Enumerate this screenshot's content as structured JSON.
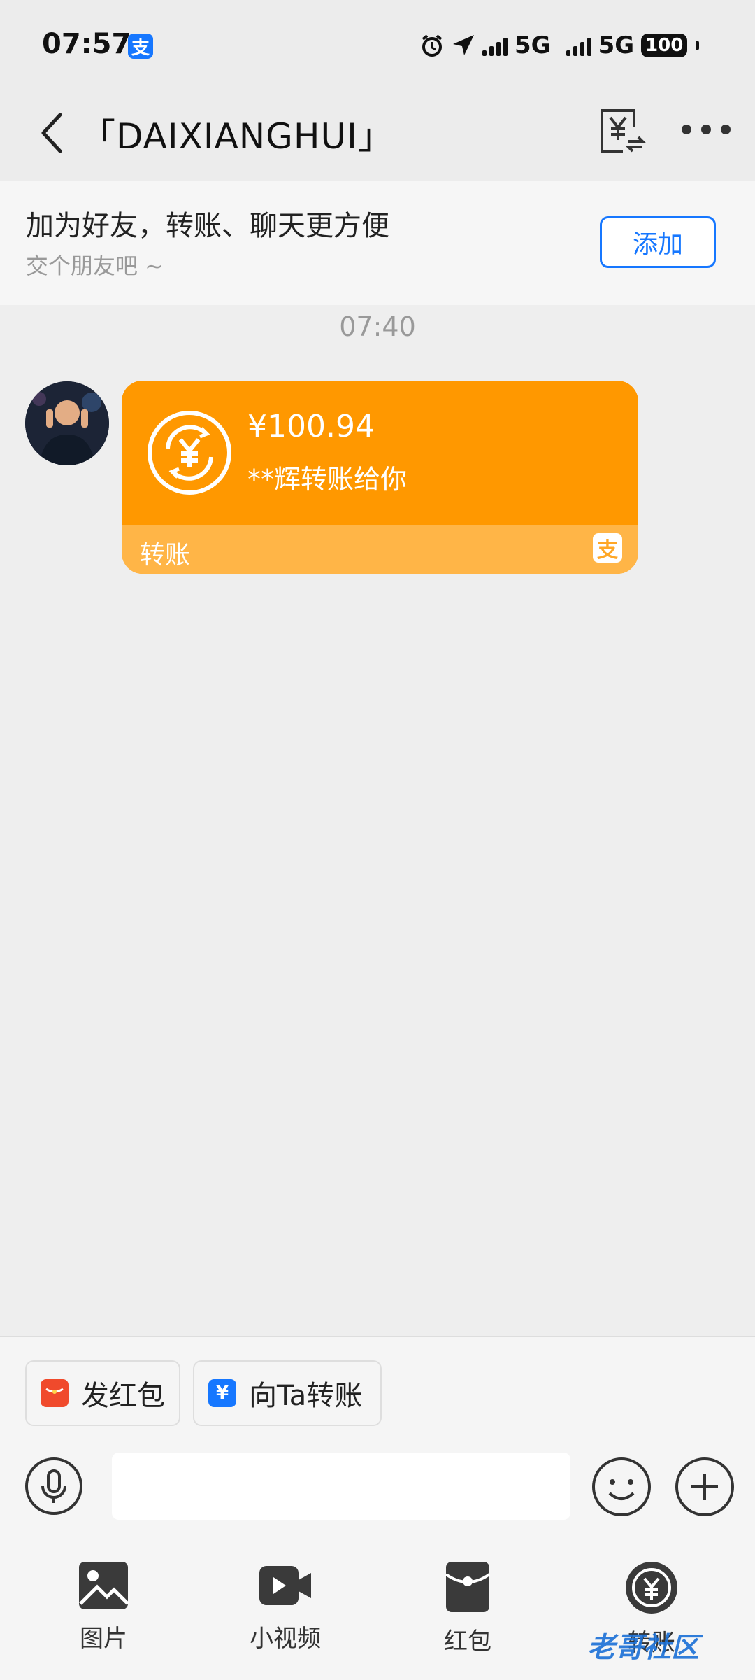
{
  "status_bar": {
    "time": "07:57",
    "app_badge": "支",
    "network_1": "5G",
    "network_2": "5G",
    "battery": "100"
  },
  "header": {
    "title": "「DAIXIANGHUI」"
  },
  "banner": {
    "title": "加为好友，转账、聊天更方便",
    "subtitle": "交个朋友吧 ~",
    "add_button": "添加"
  },
  "conversation": {
    "timestamp": "07:40",
    "transfer_card": {
      "amount": "¥100.94",
      "description": "**辉转账给你",
      "label": "转账",
      "logo": "支"
    }
  },
  "quick_actions": [
    {
      "label": "发红包",
      "icon": "red-envelope-icon",
      "color": "#f04a2c"
    },
    {
      "label": "向Ta转账",
      "icon": "transfer-yuan-icon",
      "color": "#1677ff"
    }
  ],
  "input": {
    "placeholder": ""
  },
  "toolbar": [
    {
      "label": "图片",
      "icon": "image-icon"
    },
    {
      "label": "小视频",
      "icon": "video-icon"
    },
    {
      "label": "红包",
      "icon": "red-envelope-icon"
    },
    {
      "label": "转账",
      "icon": "transfer-icon"
    }
  ],
  "watermark": "老哥社区",
  "colors": {
    "accent": "#1677ff",
    "card": "#ff9800",
    "card_footer": "#ffb547",
    "background": "#eeeeee"
  }
}
